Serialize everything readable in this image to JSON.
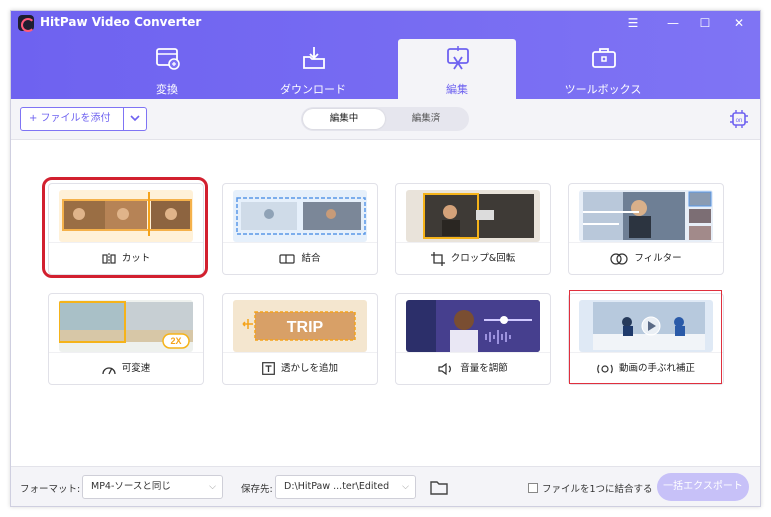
{
  "app": {
    "title": "HitPaw Video Converter"
  },
  "window_controls": {
    "menu": "☰",
    "minimize": "—",
    "maximize": "☐",
    "close": "✕"
  },
  "nav": {
    "tabs": [
      {
        "label": "変換",
        "icon": "convert-icon"
      },
      {
        "label": "ダウンロード",
        "icon": "download-icon"
      },
      {
        "label": "編集",
        "icon": "edit-icon",
        "active": true
      },
      {
        "label": "ツールボックス",
        "icon": "toolbox-icon"
      }
    ]
  },
  "toolbar": {
    "add_file_label": "+ ファイルを添付",
    "segment": [
      {
        "label": "編集中",
        "active": true
      },
      {
        "label": "編集済",
        "active": false
      }
    ]
  },
  "tools": [
    {
      "label": "カット",
      "icon": "cut-icon"
    },
    {
      "label": "結合",
      "icon": "merge-icon"
    },
    {
      "label": "クロップ&回転",
      "icon": "crop-icon"
    },
    {
      "label": "フィルター",
      "icon": "filter-icon"
    },
    {
      "label": "可変速",
      "icon": "speed-icon",
      "badge": "2X"
    },
    {
      "label": "透かしを追加",
      "icon": "watermark-icon",
      "thumb_text": "TRIP"
    },
    {
      "label": "音量を調節",
      "icon": "volume-icon"
    },
    {
      "label": "動画の手ぶれ補正",
      "icon": "stabilize-icon"
    }
  ],
  "bottom": {
    "format_label": "フォーマット:",
    "format_value": "MP4-ソースと同じ",
    "save_label": "保存先:",
    "save_value": "D:\\HitPaw ...ter\\Edited",
    "merge_label": "ファイルを1つに結合する",
    "export_label": "一括エクスポート"
  },
  "colors": {
    "accent": "#6e62f0",
    "highlight_red": "#d2202f"
  }
}
